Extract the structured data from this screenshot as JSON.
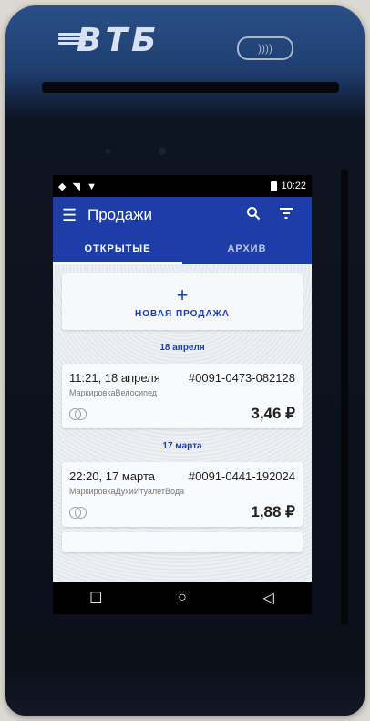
{
  "device": {
    "brand": "ВТБ",
    "nfc_icon": "contactless-icon"
  },
  "status_bar": {
    "time": "10:22",
    "icons": [
      "data-arrows-icon",
      "signal-icon",
      "wifi-icon",
      "battery-icon"
    ]
  },
  "app_bar": {
    "title": "Продажи",
    "menu_icon": "menu-icon",
    "search_icon": "search-icon",
    "filter_icon": "filter-icon"
  },
  "tabs": [
    {
      "label": "ОТКРЫТЫЕ",
      "active": true
    },
    {
      "label": "АРХИВ",
      "active": false
    }
  ],
  "new_sale": {
    "plus": "+",
    "label": "НОВАЯ ПРОДАЖА"
  },
  "groups": [
    {
      "date": "18 апреля",
      "sales": [
        {
          "time": "11:21, 18 апреля",
          "number": "#0091-0473-082128",
          "goods": "МаркировкаВелосипед",
          "amount": "3,46 ₽"
        }
      ]
    },
    {
      "date": "17 марта",
      "sales": [
        {
          "time": "22:20, 17 марта",
          "number": "#0091-0441-192024",
          "goods": "МаркировкаДухиИтуалетВода",
          "amount": "1,88 ₽"
        }
      ]
    }
  ],
  "colors": {
    "primary": "#1d3ea7",
    "device_blue": "#2a4f86"
  }
}
